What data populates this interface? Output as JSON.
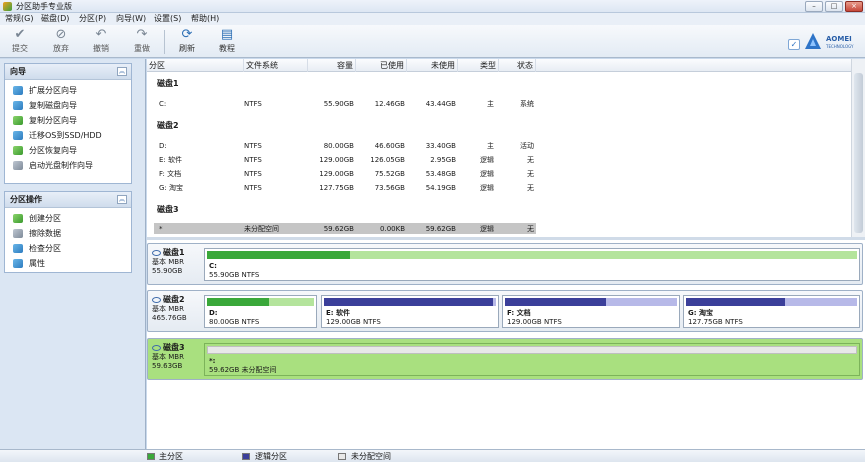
{
  "window": {
    "title": "分区助手专业版",
    "btn_min": "–",
    "btn_max": "□",
    "btn_close": "×"
  },
  "menu": [
    "常规(G)",
    "磁盘(D)",
    "分区(P)",
    "向导(W)",
    "设置(S)",
    "帮助(H)"
  ],
  "toolbar": {
    "items": [
      {
        "label": "提交",
        "icon": "check-icon"
      },
      {
        "label": "放弃",
        "icon": "discard-icon"
      },
      {
        "label": "撤销",
        "icon": "undo-icon"
      },
      {
        "label": "重做",
        "icon": "redo-icon"
      },
      {
        "label": "刷新",
        "icon": "refresh-icon"
      },
      {
        "label": "教程",
        "icon": "tutorial-icon"
      }
    ]
  },
  "brand": {
    "name": "AOMEI",
    "sub": "TECHNOLOGY",
    "accent": "#2e74c8"
  },
  "wizard_panel": {
    "title": "向导",
    "items": [
      "扩展分区向导",
      "复制磁盘向导",
      "复制分区向导",
      "迁移OS到SSD/HDD",
      "分区恢复向导",
      "启动光盘制作向导"
    ]
  },
  "ops_panel": {
    "title": "分区操作",
    "items": [
      "创建分区",
      "擦除数据",
      "检查分区",
      "属性"
    ]
  },
  "table": {
    "headers": [
      "分区",
      "文件系统",
      "容量",
      "已使用",
      "未使用",
      "类型",
      "状态"
    ],
    "disks": [
      {
        "name": "磁盘1",
        "rows": [
          {
            "part": "C:",
            "fs": "NTFS",
            "cap": "55.90GB",
            "used": "12.46GB",
            "free": "43.44GB",
            "type": "主",
            "status": "系统"
          }
        ]
      },
      {
        "name": "磁盘2",
        "rows": [
          {
            "part": "D:",
            "fs": "NTFS",
            "cap": "80.00GB",
            "used": "46.60GB",
            "free": "33.40GB",
            "type": "主",
            "status": "活动"
          },
          {
            "part": "E: 软件",
            "fs": "NTFS",
            "cap": "129.00GB",
            "used": "126.05GB",
            "free": "2.95GB",
            "type": "逻辑",
            "status": "无"
          },
          {
            "part": "F: 文档",
            "fs": "NTFS",
            "cap": "129.00GB",
            "used": "75.52GB",
            "free": "53.48GB",
            "type": "逻辑",
            "status": "无"
          },
          {
            "part": "G: 淘宝",
            "fs": "NTFS",
            "cap": "127.75GB",
            "used": "73.56GB",
            "free": "54.19GB",
            "type": "逻辑",
            "status": "无"
          }
        ]
      },
      {
        "name": "磁盘3",
        "rows": [
          {
            "part": "*",
            "fs": "未分配空间",
            "cap": "59.62GB",
            "used": "0.00KB",
            "free": "59.62GB",
            "type": "逻辑",
            "status": "无"
          }
        ]
      }
    ]
  },
  "disk_cards": [
    {
      "title": "磁盘1",
      "kind": "基本 MBR",
      "size": "55.90GB",
      "parts": [
        {
          "name": "C:",
          "size": "55.90GB NTFS",
          "used_fraction": 0.22,
          "kind": "primary"
        }
      ]
    },
    {
      "title": "磁盘2",
      "kind": "基本 MBR",
      "size": "465.76GB",
      "parts": [
        {
          "name": "D:",
          "size": "80.00GB NTFS",
          "used_fraction": 0.58,
          "kind": "primary"
        },
        {
          "name": "E: 软件",
          "size": "129.00GB NTFS",
          "used_fraction": 0.98,
          "kind": "logical"
        },
        {
          "name": "F: 文档",
          "size": "129.00GB NTFS",
          "used_fraction": 0.59,
          "kind": "logical"
        },
        {
          "name": "G: 淘宝",
          "size": "127.75GB NTFS",
          "used_fraction": 0.58,
          "kind": "logical"
        }
      ]
    },
    {
      "title": "磁盘3",
      "kind": "基本 MBR",
      "size": "59.63GB",
      "parts": [
        {
          "name": "*:",
          "size": "59.62GB 未分配空间",
          "used_fraction": 0,
          "kind": "unallocated"
        }
      ]
    }
  ],
  "legend": [
    "主分区",
    "逻辑分区",
    "未分配空间"
  ],
  "colors": {
    "primary": "#3aa83a",
    "logical": "#3b3f9a",
    "unallocated": "#e8e8e8",
    "selected_row": "#c5c5c5",
    "disk3_bg": "#a9e07f"
  }
}
